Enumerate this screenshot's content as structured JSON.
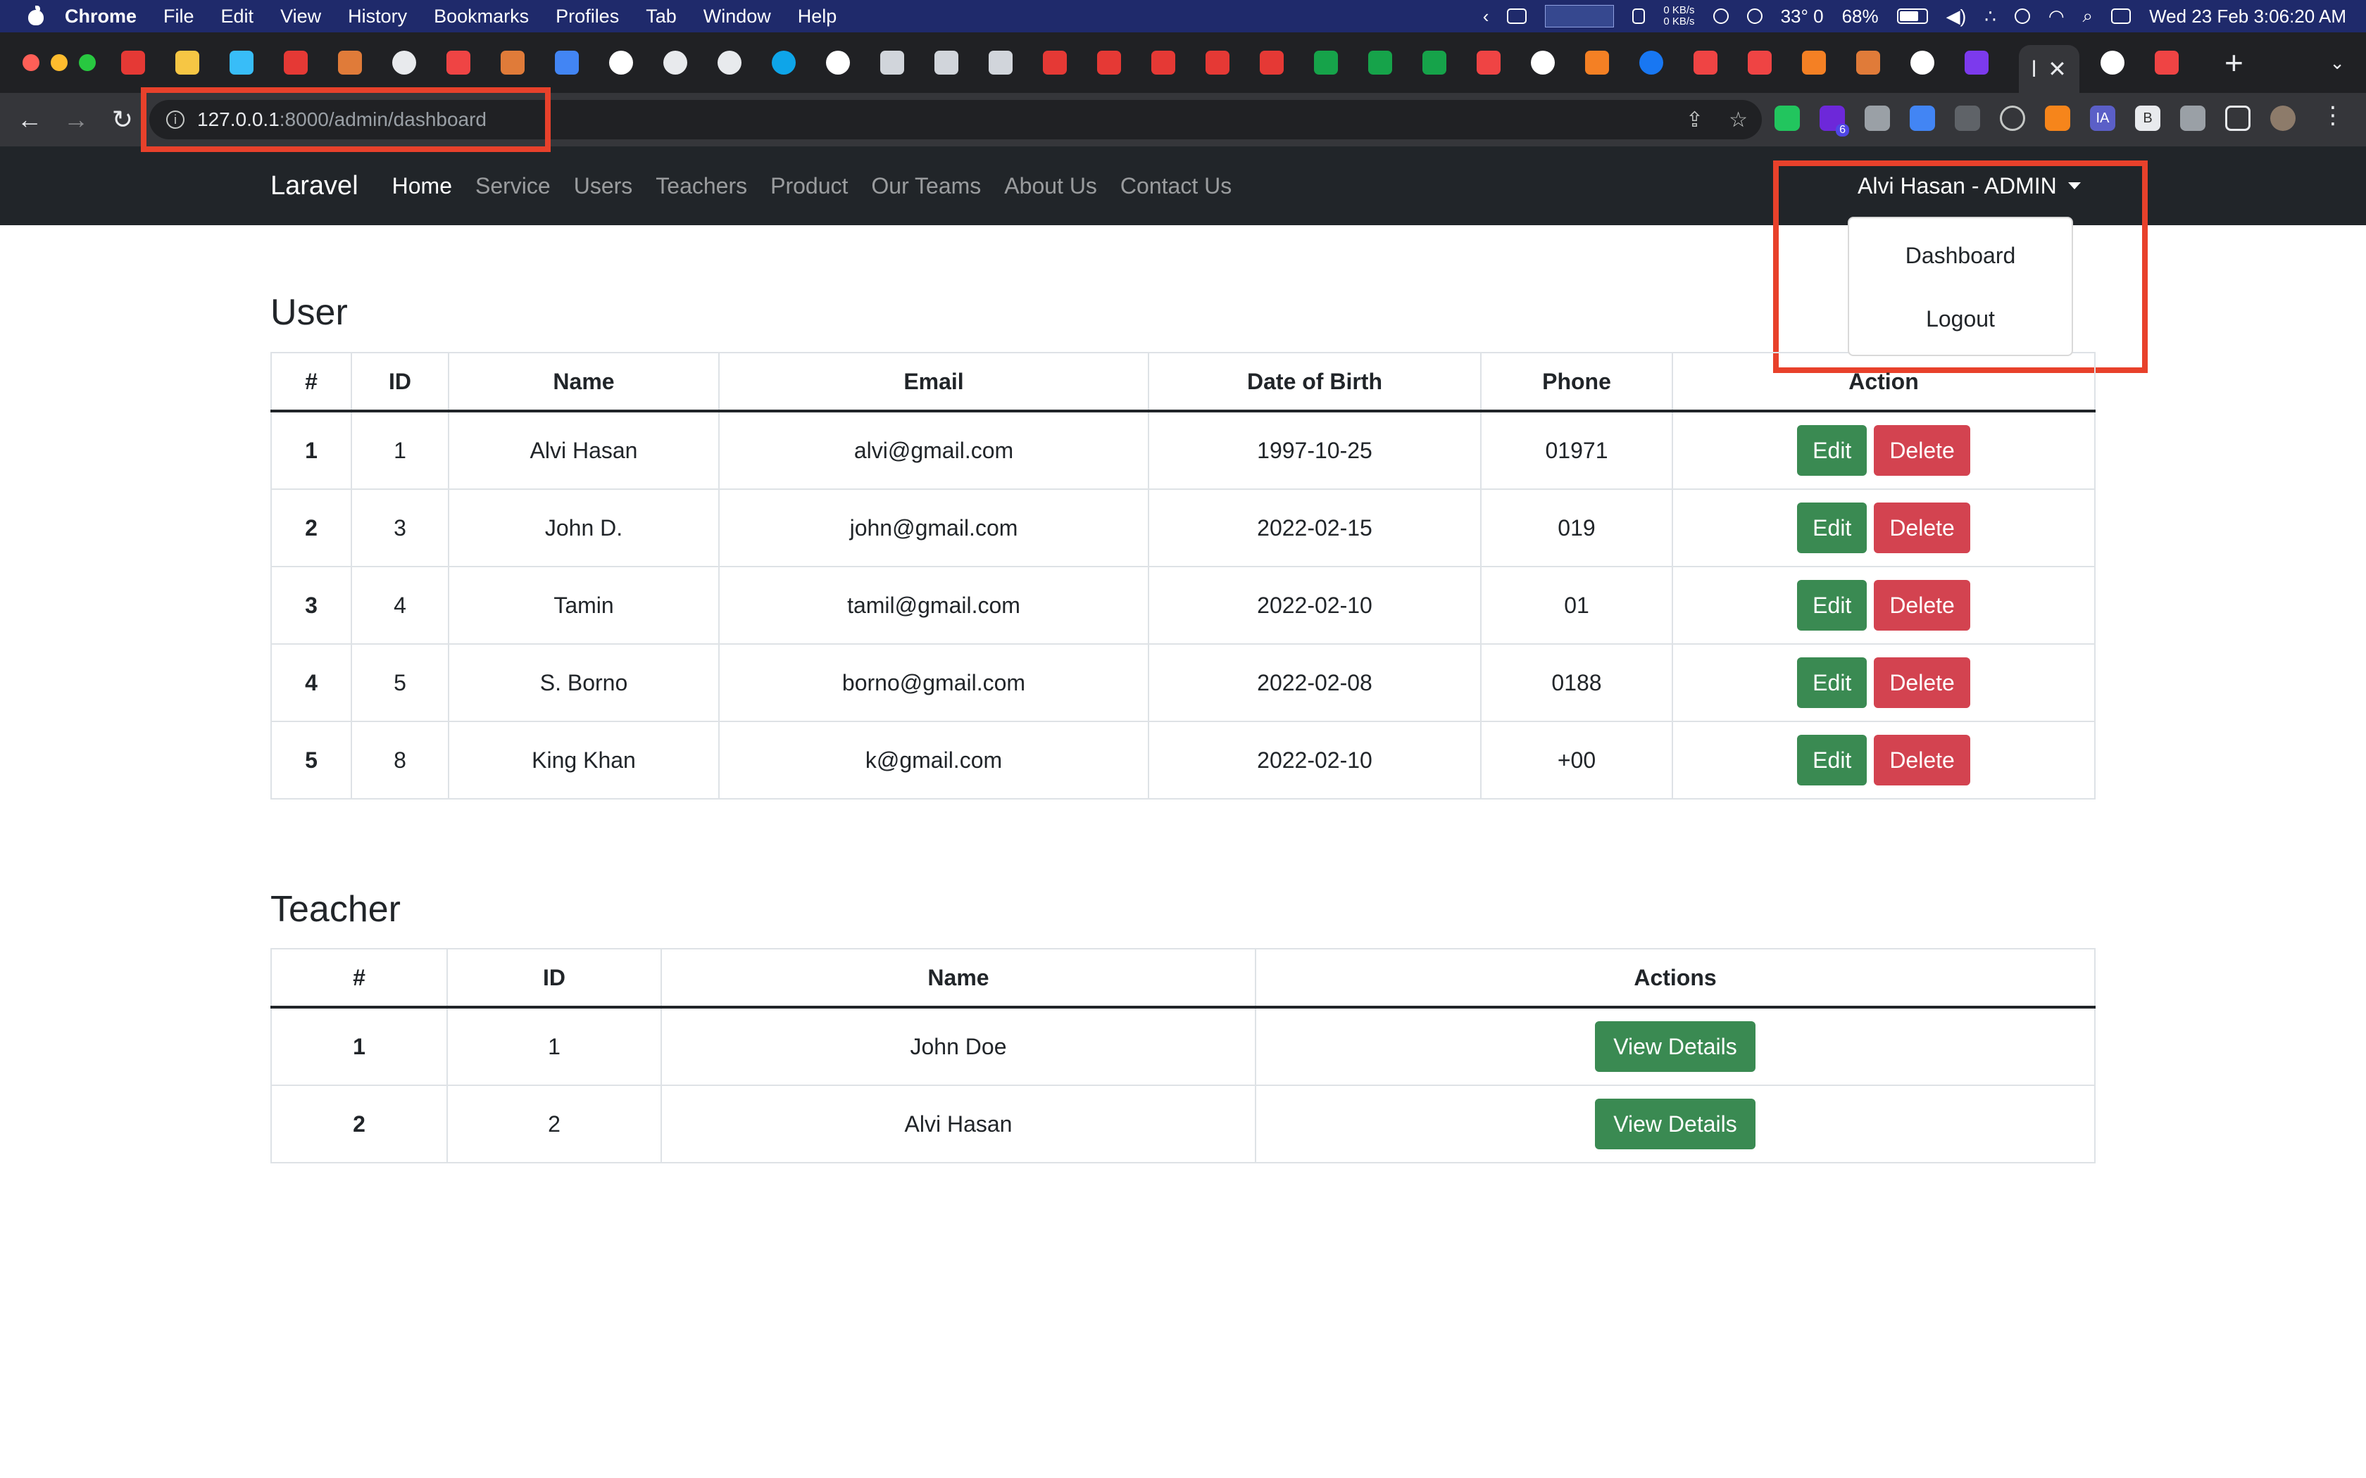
{
  "mac_menu": {
    "app": "Chrome",
    "items": [
      "File",
      "Edit",
      "View",
      "History",
      "Bookmarks",
      "Profiles",
      "Tab",
      "Window",
      "Help"
    ],
    "net_up": "0 KB/s",
    "net_down": "0 KB/s",
    "temperature": "33° 0",
    "battery": "68%",
    "clock": "Wed 23 Feb  3:06:20 AM"
  },
  "browser": {
    "url_host": "127.0.0.1",
    "url_rest": ":8000/admin/dashboard",
    "active_tab_title": "l",
    "extension_badge": "6",
    "extension_ia": "IA",
    "extension_b": "B"
  },
  "navbar": {
    "brand": "Laravel",
    "links": [
      "Home",
      "Service",
      "Users",
      "Teachers",
      "Product",
      "Our Teams",
      "About Us",
      "Contact Us"
    ],
    "user_label": "Alvi Hasan - ADMIN"
  },
  "dropdown": {
    "items": [
      "Dashboard",
      "Logout"
    ]
  },
  "users_section": {
    "title": "User",
    "headers": [
      "#",
      "ID",
      "Name",
      "Email",
      "Date of Birth",
      "Phone",
      "Action"
    ],
    "rows": [
      [
        "1",
        "1",
        "Alvi Hasan",
        "alvi@gmail.com",
        "1997-10-25",
        "01971"
      ],
      [
        "2",
        "3",
        "John D.",
        "john@gmail.com",
        "2022-02-15",
        "019"
      ],
      [
        "3",
        "4",
        "Tamin",
        "tamil@gmail.com",
        "2022-02-10",
        "01"
      ],
      [
        "4",
        "5",
        "S. Borno",
        "borno@gmail.com",
        "2022-02-08",
        "0188"
      ],
      [
        "5",
        "8",
        "King Khan",
        "k@gmail.com",
        "2022-02-10",
        "+00"
      ]
    ],
    "edit_label": "Edit",
    "delete_label": "Delete"
  },
  "teachers_section": {
    "title": "Teacher",
    "headers": [
      "#",
      "ID",
      "Name",
      "Actions"
    ],
    "rows": [
      [
        "1",
        "1",
        "John Doe"
      ],
      [
        "2",
        "2",
        "Alvi Hasan"
      ]
    ],
    "view_label": "View Details"
  },
  "colors": {
    "navbar_bg": "#212529",
    "edit_button": "#3a8a52",
    "delete_button": "#d34350",
    "highlight_box": "#e8412b"
  }
}
